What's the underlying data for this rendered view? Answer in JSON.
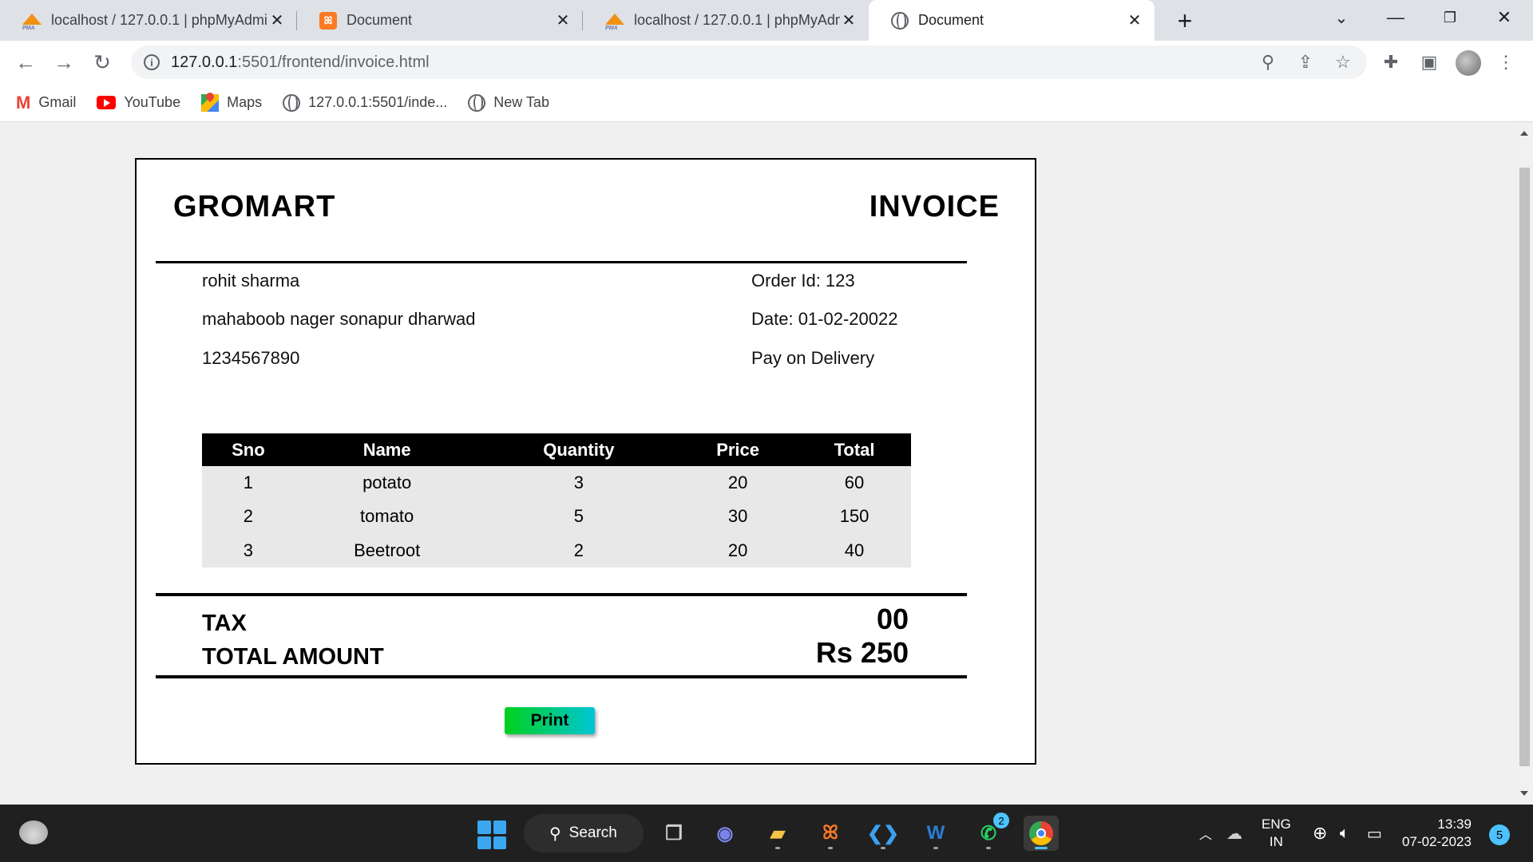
{
  "browser": {
    "tabs": [
      {
        "title": "localhost / 127.0.0.1 | phpMyAdmin",
        "icon": "phpmyadmin-icon",
        "active": false
      },
      {
        "title": "Document",
        "icon": "xampp-icon",
        "active": false
      },
      {
        "title": "localhost / 127.0.0.1 | phpMyAdmin",
        "icon": "phpmyadmin-icon",
        "active": false
      },
      {
        "title": "Document",
        "icon": "globe-icon",
        "active": true
      }
    ],
    "url_host": "127.0.0.1",
    "url_rest": ":5501/frontend/invoice.html",
    "bookmarks": [
      {
        "label": "Gmail",
        "icon": "gmail-icon"
      },
      {
        "label": "YouTube",
        "icon": "youtube-icon"
      },
      {
        "label": "Maps",
        "icon": "maps-icon"
      },
      {
        "label": "127.0.0.1:5501/inde...",
        "icon": "globe-icon"
      },
      {
        "label": "New Tab",
        "icon": "globe-icon"
      }
    ]
  },
  "invoice": {
    "brand": "GROMART",
    "title": "INVOICE",
    "customer": {
      "name": "rohit sharma",
      "address": "mahaboob nager sonapur dharwad",
      "phone": "1234567890"
    },
    "order": {
      "id": "Order Id: 123",
      "date": "Date: 01-02-20022",
      "payment": "Pay on Delivery"
    },
    "table": {
      "headers": [
        "Sno",
        "Name",
        "Quantity",
        "Price",
        "Total"
      ],
      "rows": [
        [
          "1",
          "potato",
          "3",
          "20",
          "60"
        ],
        [
          "2",
          "tomato",
          "5",
          "30",
          "150"
        ],
        [
          "3",
          "Beetroot",
          "2",
          "20",
          "40"
        ]
      ]
    },
    "tax_label": "TAX",
    "tax_value": "00",
    "total_label": "TOTAL AMOUNT",
    "total_value": "Rs 250",
    "print_label": "Print"
  },
  "taskbar": {
    "search_label": "Search",
    "whatsapp_badge": "2",
    "lang_line1": "ENG",
    "lang_line2": "IN",
    "time": "13:39",
    "date": "07-02-2023",
    "notifications": "5"
  },
  "colors": {
    "accent": "#4cc2ff",
    "print_gradient_start": "#00d01e",
    "print_gradient_end": "#00c6d6"
  }
}
